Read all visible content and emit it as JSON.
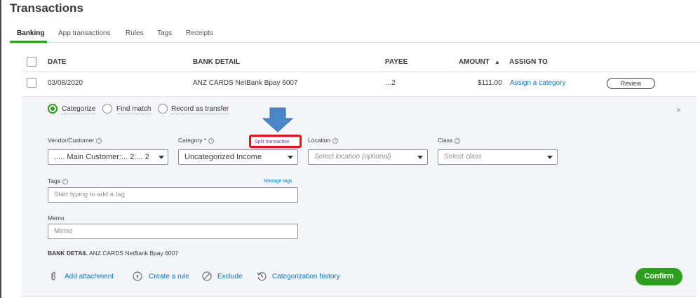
{
  "page": {
    "title": "Transactions"
  },
  "tabs": [
    "Banking",
    "App transactions",
    "Rules",
    "Tags",
    "Receipts"
  ],
  "table": {
    "headers": {
      "date": "DATE",
      "bank_detail": "BANK DETAIL",
      "payee": "PAYEE",
      "amount": "AMOUNT",
      "sort_indicator": "▲",
      "assign_to": "ASSIGN TO"
    },
    "row": {
      "date": "03/08/2020",
      "bank_detail": "ANZ CARDS NetBank Bpay 6007",
      "payee": "...2",
      "amount": "$111.00",
      "assign_to": "Assign a category",
      "action": "Review"
    }
  },
  "panel": {
    "radios": [
      {
        "label": "Categorize",
        "selected": true
      },
      {
        "label": "Find match",
        "selected": false
      },
      {
        "label": "Record as transfer",
        "selected": false
      }
    ],
    "close": "×",
    "vendor": {
      "label": "Vendor/Customer",
      "value": "..... Main Customer:... 2:... 2"
    },
    "category": {
      "label": "Category *",
      "value": "Uncategorized Income"
    },
    "split_transaction": "Split transaction",
    "location": {
      "label": "Location",
      "placeholder": "Select location (optional)"
    },
    "class": {
      "label": "Class",
      "placeholder": "Select class"
    },
    "tags": {
      "label": "Tags",
      "placeholder": "Start typing to add a tag",
      "manage": "Manage tags"
    },
    "memo": {
      "label": "Memo",
      "placeholder": "Memo"
    },
    "bank_detail_label": "BANK DETAIL",
    "bank_detail_value": "ANZ CARDS NetBank Bpay 6007",
    "footer": {
      "add_attachment": "Add attachment",
      "create_rule": "Create a rule",
      "exclude": "Exclude",
      "history": "Categorization history",
      "confirm": "Confirm"
    }
  },
  "colors": {
    "brand_green": "#2ca01c",
    "link_blue": "#0077c5",
    "annotation_red": "#e4131b",
    "annotation_arrow": "#4a86c8"
  },
  "icons": {
    "help": "question-circle-icon",
    "attachment": "paperclip-icon",
    "rule": "lightning-icon",
    "exclude": "ban-icon",
    "history": "history-icon",
    "annotation": "down-arrow-icon"
  }
}
